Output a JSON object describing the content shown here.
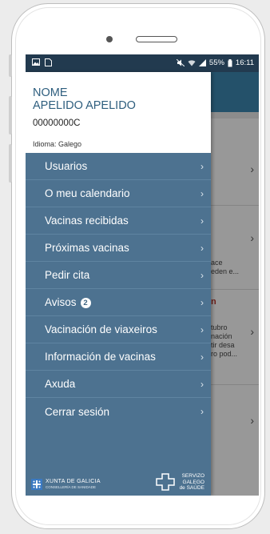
{
  "statusbar": {
    "left_icons": [
      "image-icon",
      "sim-icon"
    ],
    "battery_text": "55%",
    "time": "16:11"
  },
  "profile": {
    "name": "NOME",
    "surname": "APELIDO APELIDO",
    "id": "00000000C",
    "language": "Idioma: Galego"
  },
  "menu": {
    "items": [
      {
        "label": "Usuarios"
      },
      {
        "label": "O meu calendario"
      },
      {
        "label": "Vacinas recibidas"
      },
      {
        "label": "Próximas vacinas"
      },
      {
        "label": "Pedir cita"
      },
      {
        "label": "Avisos",
        "badge": "2"
      },
      {
        "label": "Vacinación de viaxeiros"
      },
      {
        "label": "Información de vacinas"
      },
      {
        "label": "Axuda"
      },
      {
        "label": "Cerrar sesión"
      }
    ],
    "chevron": "›"
  },
  "background": {
    "snippet_1": "ace\neden e...",
    "snippet_2_title": "n",
    "snippet_2": "tubro\nnación\ntir desa\nro pod..."
  },
  "footer": {
    "xunta_title": "XUNTA DE GALICIA",
    "xunta_sub": "CONSELLERÍA DE SANIDADE",
    "sergas_line1": "SERVIZO",
    "sergas_line2": "GALEGO",
    "sergas_line3": "de SAÚDE"
  },
  "colors": {
    "drawer": "#4d7290",
    "header": "#24516a",
    "statusbar": "#223a4f"
  }
}
